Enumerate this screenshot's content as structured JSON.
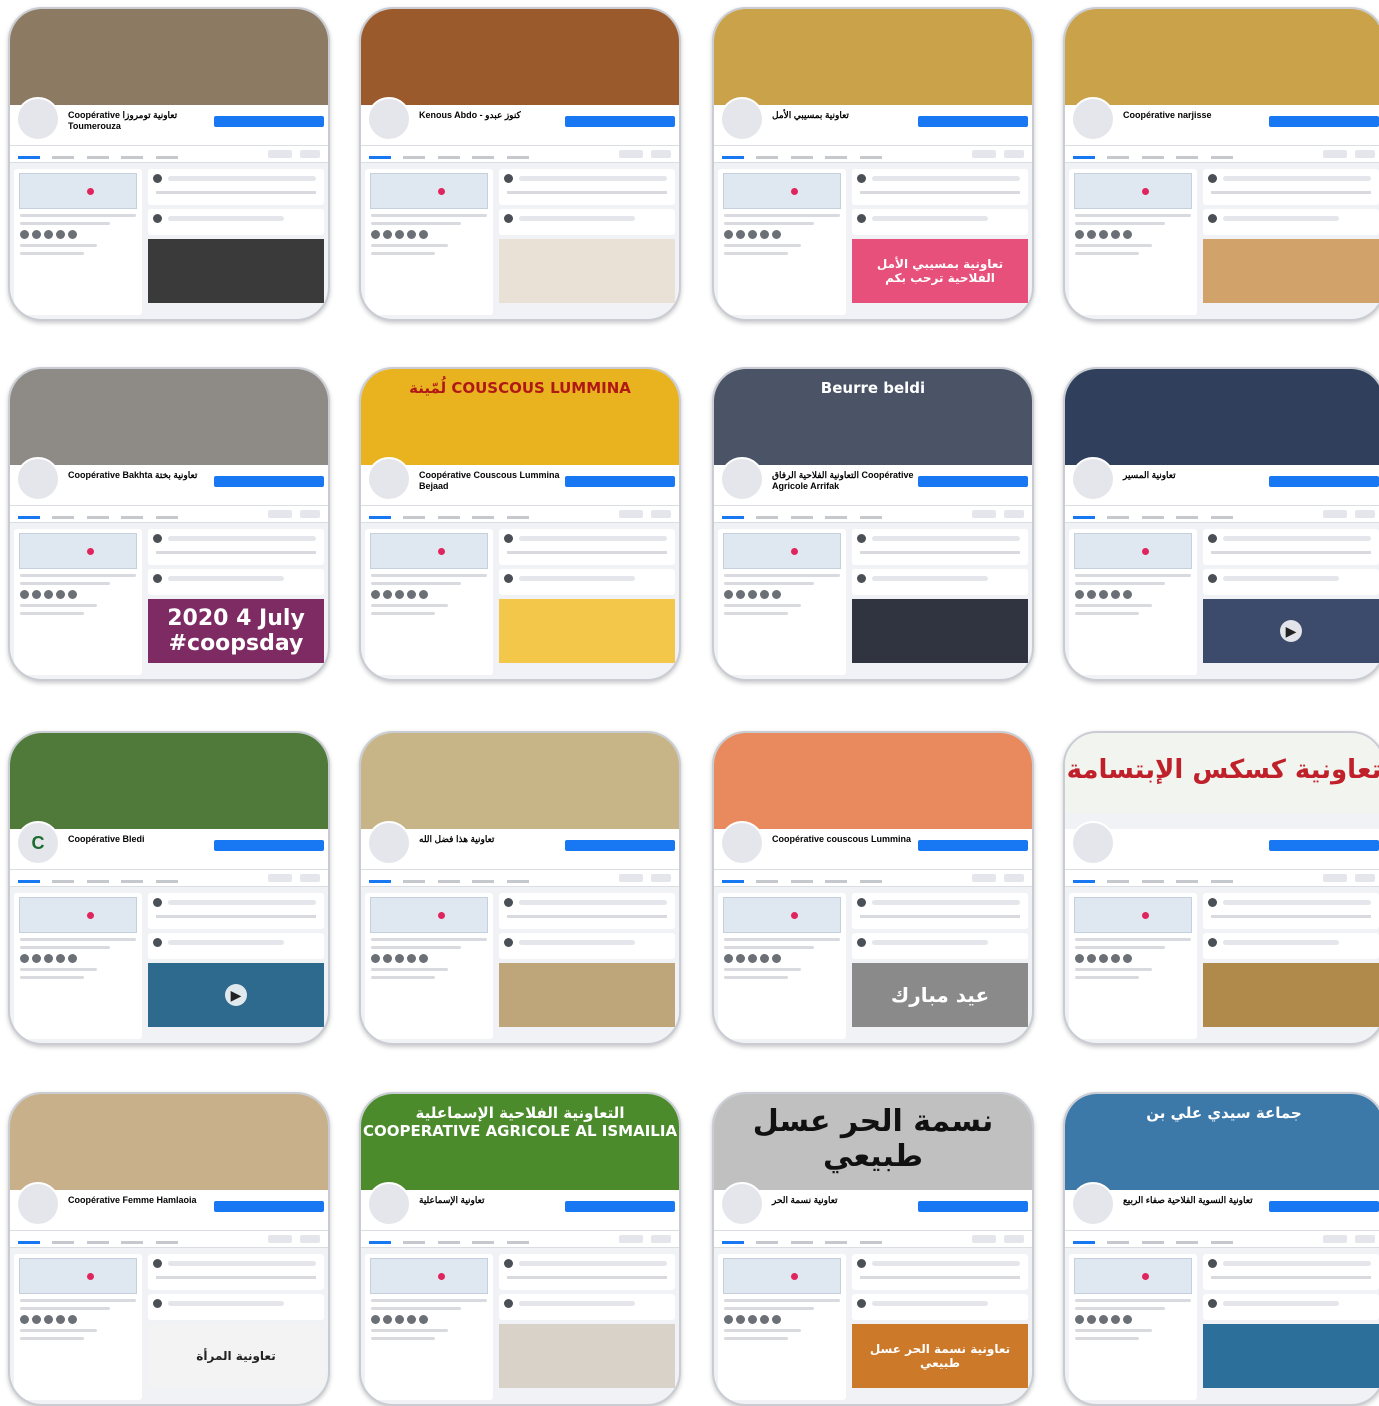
{
  "tiles": [
    {
      "name": "Coopérative تعاونية تومروزا Toumerouza",
      "sub": "",
      "cover_text": "",
      "avatar": "",
      "media_text": "",
      "media_icon": ""
    },
    {
      "name": "Kenous Abdo - كنوز عبدو",
      "sub": "",
      "cover_text": "",
      "avatar": "",
      "media_text": "",
      "media_icon": ""
    },
    {
      "name": "تعاونية بمسيبي الأمل",
      "sub": "",
      "cover_text": "",
      "avatar": "",
      "media_text": "تعاونية بمسيبي الأمل الفلاحية ترحب بكم",
      "media_icon": ""
    },
    {
      "name": "Coopérative narjisse",
      "sub": "",
      "cover_text": "",
      "avatar": "",
      "media_text": "",
      "media_icon": ""
    },
    {
      "name": "Coopérative Bakhta تعاونية بختة",
      "sub": "",
      "cover_text": "",
      "avatar": "",
      "media_text": "2020 4 July #coopsday",
      "media_icon": ""
    },
    {
      "name": "Coopérative Couscous Lummina Bejaad",
      "sub": "",
      "cover_text": "لُمّينة COUSCOUS LUMMINA",
      "avatar": "",
      "media_text": "",
      "media_icon": ""
    },
    {
      "name": "التعاونية الفلاحية الرفاق Coopérative Agricole Arrifak",
      "sub": "",
      "cover_text": "Beurre beldi",
      "avatar": "",
      "media_text": "",
      "media_icon": ""
    },
    {
      "name": "تعاونية المسير",
      "sub": "",
      "cover_text": "",
      "avatar": "",
      "media_text": "",
      "media_icon": "▶"
    },
    {
      "name": "Coopérative Bledi",
      "sub": "",
      "cover_text": "",
      "avatar": "C",
      "media_text": "",
      "media_icon": "▶"
    },
    {
      "name": "تعاونية هذا فضل الله",
      "sub": "",
      "cover_text": "",
      "avatar": "",
      "media_text": "",
      "media_icon": ""
    },
    {
      "name": "Coopérative couscous Lummina",
      "sub": "",
      "cover_text": "",
      "avatar": "",
      "media_text": "عيد مبارك",
      "media_icon": ""
    },
    {
      "name": "",
      "sub": "",
      "cover_text": "تعاونية كسكس الإبتسامة",
      "avatar": "",
      "media_text": "",
      "media_icon": ""
    },
    {
      "name": "Coopérative Femme Hamlaoia",
      "sub": "",
      "cover_text": "",
      "avatar": "",
      "media_text": "تعاونية المرأة",
      "media_icon": ""
    },
    {
      "name": "تعاونية الإسماعلية",
      "sub": "",
      "cover_text": "التعاونية الفلاحية الإسماعلية COOPERATIVE AGRICOLE AL ISMAILIA",
      "avatar": "",
      "media_text": "",
      "media_icon": ""
    },
    {
      "name": "تعاونية نسمة الحر",
      "sub": "",
      "cover_text": "نسمة الحر عسل طبيعي",
      "avatar": "",
      "media_text": "تعاونية نسمة الحر عسل طبيعي",
      "media_icon": ""
    },
    {
      "name": "تعاونية النسوية الفلاحية صفاء الربيع",
      "sub": "",
      "cover_text": "جماعة سيدي علي بن",
      "avatar": "",
      "media_text": "",
      "media_icon": ""
    }
  ],
  "colors": {
    "fb_blue": "#1877f2",
    "covers": [
      "#8c7a62",
      "#9a5a2c",
      "#c9a24a",
      "#c9a24a",
      "#8e8a86",
      "#e8b31f",
      "#4a5466",
      "#2f3f5c",
      "#4f7a3a",
      "#c7b487",
      "#e98a5e",
      "#f2f4ef",
      "#c8b08a",
      "#4b8b2c",
      "#c0c0c0",
      "#3d79a8"
    ],
    "media": [
      "#3a3a3a",
      "#e9e0d6",
      "#e7507a",
      "#d1a36a",
      "#7e2a63",
      "#f3c84a",
      "#2f3440",
      "#3c4a6b",
      "#2d6a8d",
      "#bfa57a",
      "#8a8a8a",
      "#b08a4a",
      "#f3f3f3",
      "#d8d2c8",
      "#cc7a2a",
      "#2c6f9a"
    ]
  }
}
